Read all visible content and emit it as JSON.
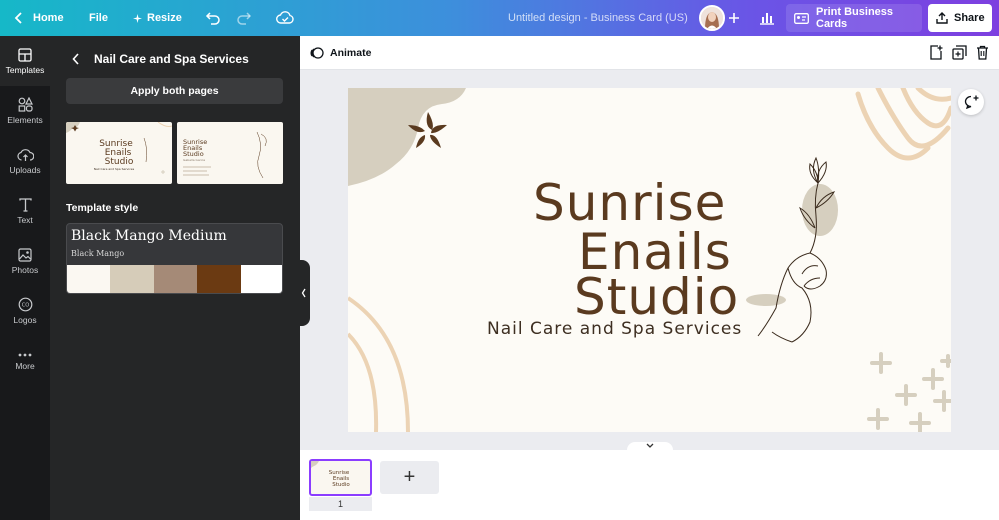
{
  "topbar": {
    "home_label": "Home",
    "file_label": "File",
    "resize_label": "Resize",
    "doc_title": "Untitled design - Business Card (US)",
    "print_label": "Print Business Cards",
    "share_label": "Share"
  },
  "rail": {
    "items": [
      {
        "label": "Templates",
        "icon": "templates-icon"
      },
      {
        "label": "Elements",
        "icon": "elements-icon"
      },
      {
        "label": "Uploads",
        "icon": "uploads-icon"
      },
      {
        "label": "Text",
        "icon": "text-icon"
      },
      {
        "label": "Photos",
        "icon": "photos-icon"
      },
      {
        "label": "Logos",
        "icon": "logos-icon"
      },
      {
        "label": "More",
        "icon": "more-icon"
      }
    ]
  },
  "panel": {
    "title": "Nail Care and Spa Services",
    "apply_label": "Apply both pages",
    "style_heading": "Template style",
    "font_name": "Black Mango Medium",
    "font_sub": "Black Mango",
    "swatches": [
      "#fbf8f2",
      "#d6ccb9",
      "#a58a77",
      "#6b3a12",
      "#ffffff"
    ],
    "thumb_front": {
      "lines": [
        "Sunrise",
        "Enails",
        "Studio"
      ],
      "tagline": "Nail Care and Spa Services"
    },
    "thumb_back": {
      "lines": [
        "Sunrise",
        "Enails",
        "Studio"
      ],
      "detail": "Isabella Garcia"
    }
  },
  "editor": {
    "animate_label": "Animate",
    "card": {
      "line1": "Sunrise",
      "line2": "Enails",
      "line3": "Studio",
      "tagline": "Nail Care and Spa Services"
    },
    "colors": {
      "brown": "#5a3a1f",
      "beige": "#d6cfbf",
      "peach": "#ecd3b4"
    }
  },
  "pages": {
    "current": "1",
    "thumb_lines": [
      "Sunrise",
      "Enails",
      "Studio"
    ],
    "add_symbol": "+"
  }
}
